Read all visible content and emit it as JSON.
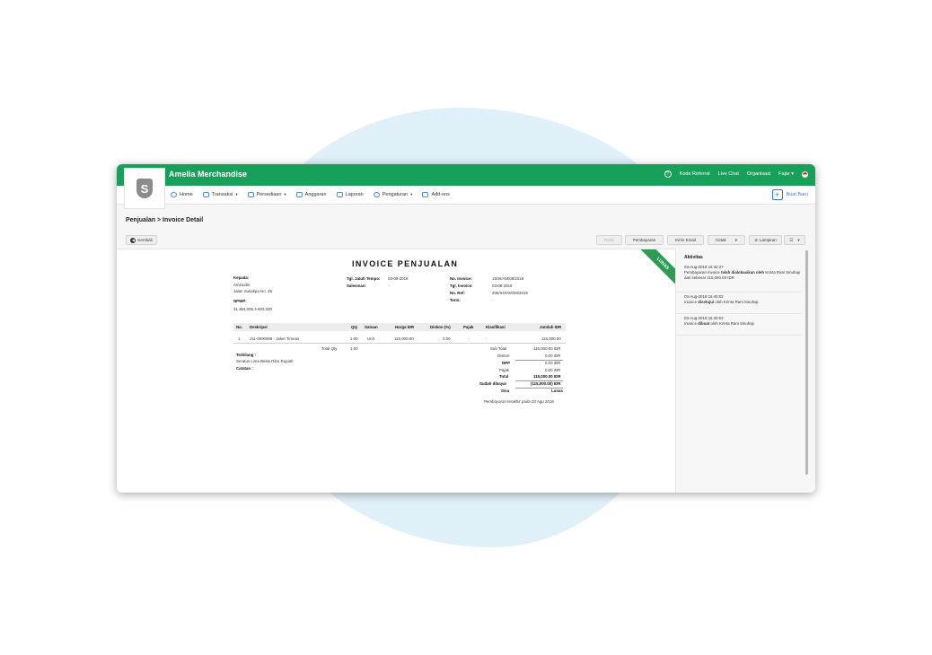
{
  "app": {
    "title": "Amelia Merchandise",
    "logo_letter": "S"
  },
  "topbar": {
    "links": [
      "Kode Referral",
      "Live Chat",
      "Organisasi"
    ],
    "user": "Fajar",
    "user_caret": "▾",
    "help": "?"
  },
  "menu": {
    "items": [
      {
        "label": "Home",
        "caret": ""
      },
      {
        "label": "Transaksi",
        "caret": "▾"
      },
      {
        "label": "Persediaan",
        "caret": "▾"
      },
      {
        "label": "Anggaran",
        "caret": ""
      },
      {
        "label": "Laporan",
        "caret": ""
      },
      {
        "label": "Pengaturan",
        "caret": "▾"
      },
      {
        "label": "Add-ons",
        "caret": ""
      }
    ],
    "create": "Buat Baru"
  },
  "breadcrumb": "Penjualan > Invoice Detail",
  "toolbar": {
    "back": "Kembali",
    "retur": "Retur",
    "pembayaran": "Pembayaran",
    "kirim_email": "Kirim Email",
    "cetak": "Cetak",
    "lampiran": "Lampiran",
    "caret": "▾",
    "menu_icon": "☰"
  },
  "invoice": {
    "title": "INVOICE PENJUALAN",
    "status": "LUNAS",
    "kepada_label": "Kepada:",
    "customer_name": "Aminudin",
    "customer_address": "Jalan Sukatipa No. 45",
    "npwp_label": "NPWP:",
    "npwp": "31.364.005.4-603.000",
    "tgl_jatuh_tempo_label": "Tgl. Jatuh Tempo:",
    "tgl_jatuh_tempo": "03-09-2018",
    "salesman_label": "Salesman:",
    "salesman": "-",
    "no_invoice_label": "No. Invoice:",
    "no_invoice": "15/SI/AM/08/2018",
    "tgl_invoice_label": "Tgl. Invoice:",
    "tgl_invoice": "03-08-2018",
    "no_ref_label": "No. Ref:",
    "no_ref": "206/SO/AM/08/2018",
    "term_label": "Term:",
    "term": "-",
    "columns": [
      "No.",
      "Deskripsi",
      "Qty",
      "Satuan",
      "Harga IDR",
      "Diskon (%)",
      "Pajak",
      "Klasifikasi",
      "Jumlah IDR"
    ],
    "items": [
      {
        "no": "1",
        "deskripsi": "J11-0000008 - Jaket Timnas",
        "qty": "1.00",
        "satuan": "Unit",
        "harga": "115,000.00",
        "diskon": "0.00",
        "pajak": "-",
        "klasifikasi": "-",
        "jumlah": "115,000.00"
      }
    ],
    "total_qty_label": "Total Qty",
    "total_qty": "1.00",
    "terbilang_label": "Terbilang :",
    "terbilang": "Seratus Lima Belas Ribu Rupiah",
    "catatan_label": "Catatan :",
    "summary": [
      {
        "label": "Sub Total",
        "value": "115,000.00 IDR"
      },
      {
        "label": "Diskon",
        "value": "0.00 IDR"
      },
      {
        "label": "DPP",
        "value": "0.00 IDR"
      },
      {
        "label": "Pajak",
        "value": "0.00 IDR"
      },
      {
        "label": "Total",
        "value": "115,000.00 IDR"
      },
      {
        "label": "Sudah dibayar",
        "value": "(115,000.00) IDR"
      },
      {
        "label": "Sisa",
        "value": "Lunas"
      }
    ],
    "last_payment": "Pembayaran terakhir pada 03 Agu 2018"
  },
  "activity": {
    "title": "Aktivitas",
    "entries": [
      {
        "time": "03-Aug-2018 16:42:27",
        "pre": "Pembayaran invoice ",
        "bold": "telah dialokasikan oleh",
        "post": " Krinta Rani Sinuhaji dari sebesar 115,000.00 IDR"
      },
      {
        "time": "03-Aug-2018 16:40:02",
        "pre": "Invoice ",
        "bold": "disetujui",
        "post": " oleh Krinta Rani Sinuhaji"
      },
      {
        "time": "03-Aug-2018 16:40:02",
        "pre": "Invoice ",
        "bold": "dibuat",
        "post": " oleh Krinta Rani Sinuhaji"
      }
    ]
  },
  "colors": {
    "brand_green": "#16a05a",
    "ribbon_green": "#2f9a52",
    "link_blue": "#2f7fd6",
    "background_blob": "#dff0f9"
  },
  "icons": [
    "shield-logo-icon",
    "help-icon",
    "flag-icon",
    "home-icon",
    "transaksi-icon",
    "persediaan-icon",
    "anggaran-icon",
    "laporan-icon",
    "pengaturan-icon",
    "add-ons-icon",
    "plus-icon",
    "back-arrow-icon",
    "paperclip-icon",
    "list-menu-icon"
  ]
}
